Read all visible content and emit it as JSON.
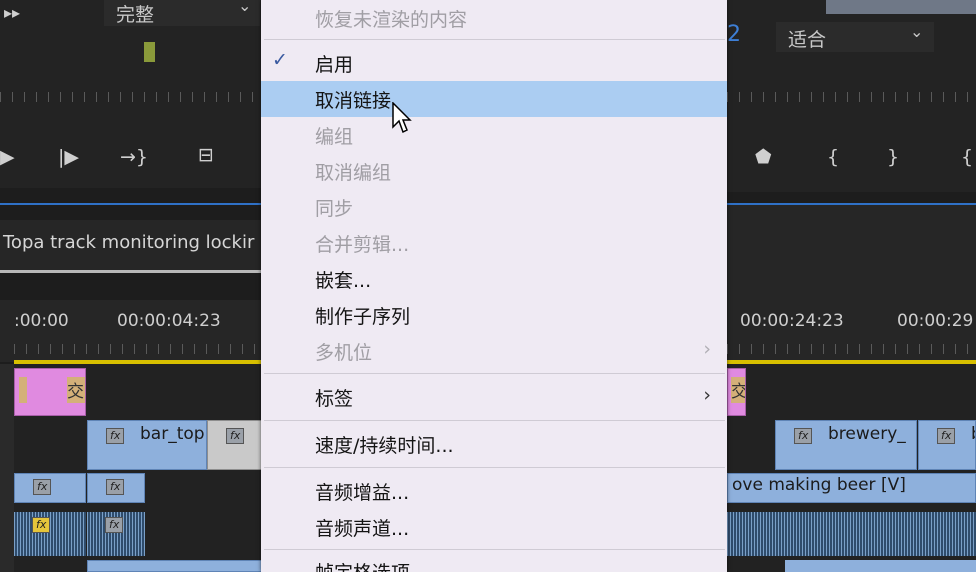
{
  "source_monitor": {
    "resolution_value": "完整",
    "dropdown_caret": "⌄",
    "sequence_tab_label": "Topa track monitoring lockir"
  },
  "program_monitor": {
    "zoom_value": "适合",
    "dropdown_caret": "⌄",
    "partial_digit": "2"
  },
  "timeline": {
    "timecodes_left": [
      ":00:00",
      "00:00:04:23"
    ],
    "timecodes_right": [
      "00:00:24:23",
      "00:00:29"
    ],
    "clips": {
      "bar_top": "bar_top",
      "brewery": "brewery_",
      "b_partial": "b",
      "love_making_beer": "ove making beer [V]",
      "fx": "fx",
      "cross": "交"
    }
  },
  "context_menu": {
    "items": [
      {
        "label": "恢复未渲染的内容",
        "enabled": false
      },
      {
        "label": "启用",
        "enabled": true,
        "checked": true
      },
      {
        "label": "取消链接",
        "enabled": true,
        "highlighted": true
      },
      {
        "label": "编组",
        "enabled": false
      },
      {
        "label": "取消编组",
        "enabled": false
      },
      {
        "label": "同步",
        "enabled": false
      },
      {
        "label": "合并剪辑...",
        "enabled": false
      },
      {
        "label": "嵌套...",
        "enabled": true
      },
      {
        "label": "制作子序列",
        "enabled": true
      },
      {
        "label": "多机位",
        "enabled": false,
        "submenu": true
      },
      {
        "label": "标签",
        "enabled": true,
        "submenu": true
      },
      {
        "label": "速度/持续时间...",
        "enabled": true
      },
      {
        "label": "音频增益...",
        "enabled": true
      },
      {
        "label": "音频声道...",
        "enabled": true
      },
      {
        "label": "帧定格选项...",
        "enabled": true
      }
    ],
    "check_glyph": "✓",
    "submenu_glyph": "›"
  },
  "colors": {
    "menu_bg": "#efeaf3",
    "menu_highlight": "#abcdf2",
    "accent_blue": "#2f71c7",
    "playhead_yellow": "#d8c000"
  }
}
